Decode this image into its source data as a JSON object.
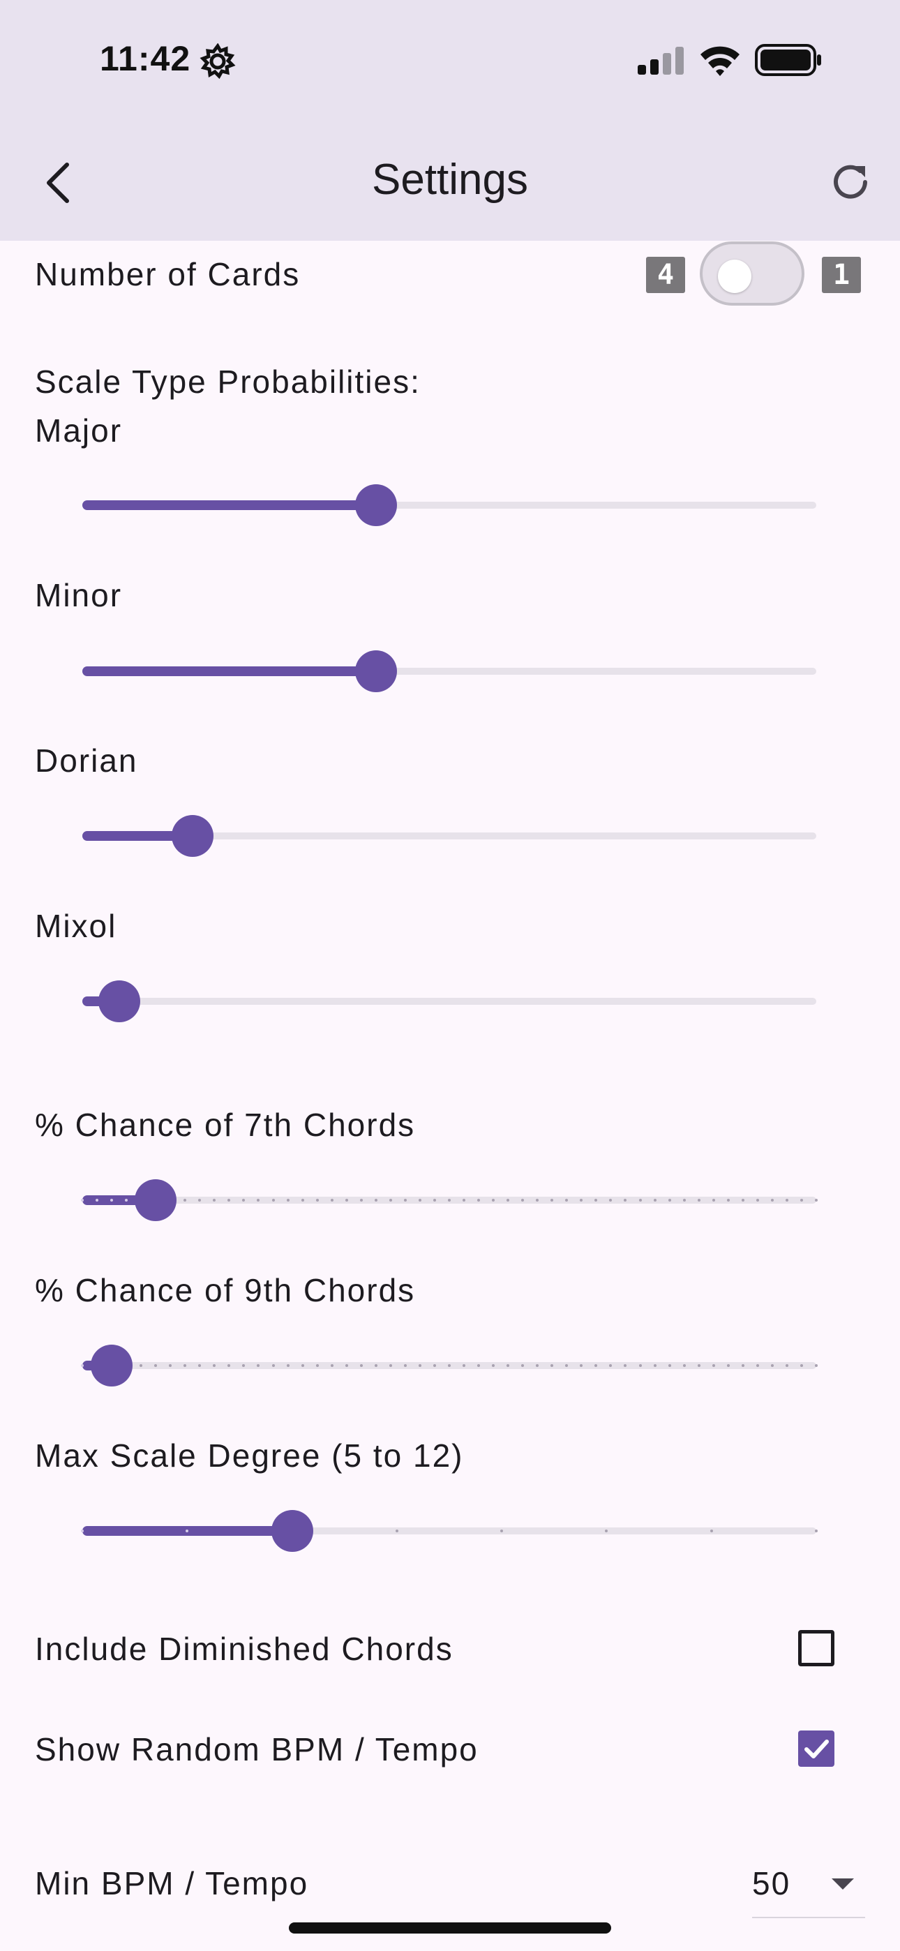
{
  "status_bar": {
    "time": "11:42"
  },
  "header": {
    "title": "Settings"
  },
  "number_of_cards": {
    "label": "Number of Cards",
    "left_value": "4",
    "right_value": "1",
    "switch_on": false
  },
  "scale_probabilities": {
    "heading": "Scale Type Probabilities:",
    "sliders": [
      {
        "label": "Major",
        "value_fraction": 0.4
      },
      {
        "label": "Minor",
        "value_fraction": 0.4
      },
      {
        "label": "Dorian",
        "value_fraction": 0.15
      },
      {
        "label": "Mixol",
        "value_fraction": 0.05
      }
    ]
  },
  "seventh_chords": {
    "label": "% Chance of 7th Chords",
    "value_fraction": 0.1,
    "divisions": 50
  },
  "ninth_chords": {
    "label": "% Chance of 9th Chords",
    "value_fraction": 0.04,
    "divisions": 50
  },
  "max_scale_degree": {
    "label": "Max Scale Degree (5 to 12)",
    "min": 5,
    "max": 12,
    "value": 7
  },
  "include_diminished": {
    "label": "Include Diminished Chords",
    "checked": false
  },
  "show_random_bpm": {
    "label": "Show Random BPM / Tempo",
    "checked": true
  },
  "min_bpm": {
    "label": "Min BPM / Tempo",
    "value": "50"
  },
  "colors": {
    "accent": "#6750a4",
    "header_bg": "#e8e2ef",
    "page_bg": "#fdf7fd"
  }
}
